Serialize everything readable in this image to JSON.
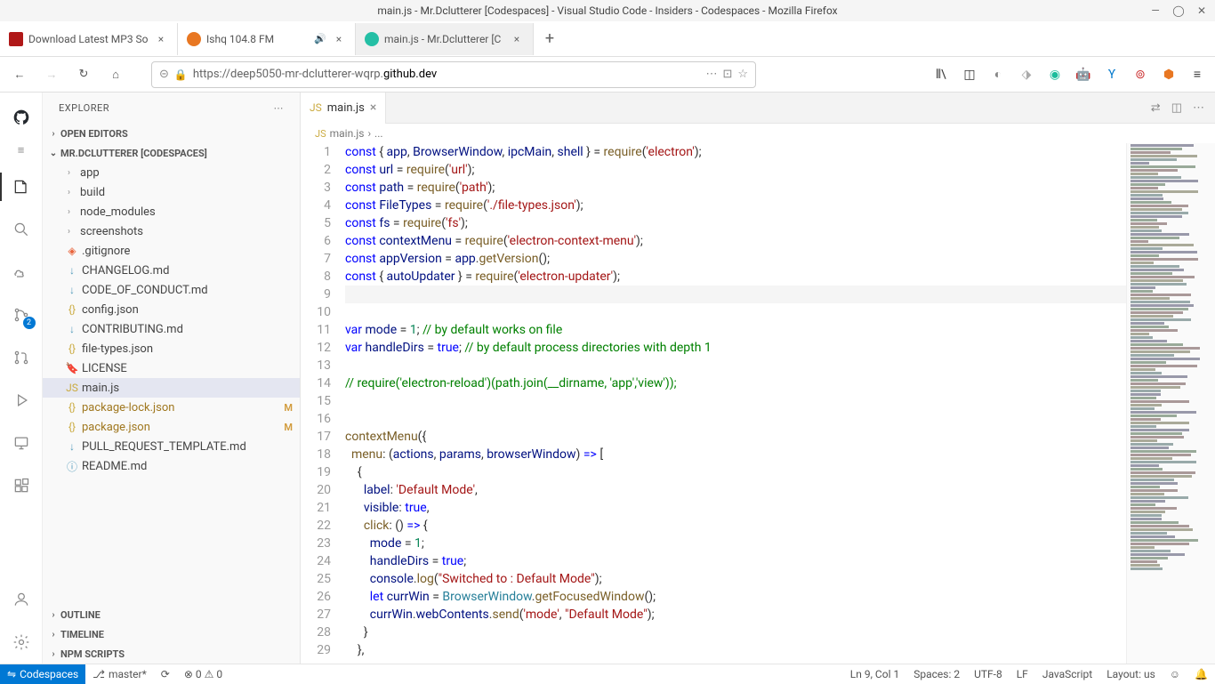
{
  "os": {
    "title": "main.js - Mr.Dclutterer [Codespaces] - Visual Studio Code - Insiders - Codespaces - Mozilla Firefox"
  },
  "browser": {
    "tabs": [
      {
        "title": "Download Latest MP3 So",
        "favicon": "#b01818"
      },
      {
        "title": "Ishq 104.8 FM",
        "favicon": "#e87722",
        "audio": true
      },
      {
        "title": "main.js - Mr.Dclutterer [C",
        "favicon": "#24bfa5",
        "active": true
      }
    ],
    "url_prefix": "https://",
    "url_sub": "deep5050-mr-dclutterer-wqrp.",
    "url_domain": "github.dev"
  },
  "sidebar": {
    "title": "EXPLORER",
    "sections": {
      "openEditors": "OPEN EDITORS",
      "repo": "MR.DCLUTTERER [CODESPACES]",
      "outline": "OUTLINE",
      "timeline": "TIMELINE",
      "npm": "NPM SCRIPTS"
    },
    "folders": [
      "app",
      "build",
      "node_modules",
      "screenshots"
    ],
    "files": [
      {
        "name": ".gitignore",
        "icon": "git"
      },
      {
        "name": "CHANGELOG.md",
        "icon": "md"
      },
      {
        "name": "CODE_OF_CONDUCT.md",
        "icon": "md"
      },
      {
        "name": "config.json",
        "icon": "json"
      },
      {
        "name": "CONTRIBUTING.md",
        "icon": "md"
      },
      {
        "name": "file-types.json",
        "icon": "json"
      },
      {
        "name": "LICENSE",
        "icon": "lic"
      },
      {
        "name": "main.js",
        "icon": "js",
        "selected": true
      },
      {
        "name": "package-lock.json",
        "icon": "json",
        "mod": "M"
      },
      {
        "name": "package.json",
        "icon": "json",
        "mod": "M"
      },
      {
        "name": "PULL_REQUEST_TEMPLATE.md",
        "icon": "md"
      },
      {
        "name": "README.md",
        "icon": "info"
      }
    ]
  },
  "editor": {
    "tab": "main.js",
    "breadcrumb": [
      "main.js",
      "..."
    ],
    "lines": 29
  },
  "status": {
    "remote": "Codespaces",
    "branch": "master*",
    "sync": "⟳",
    "errors": "⊗ 0 ⚠ 0",
    "pos": "Ln 9, Col 1",
    "spaces": "Spaces: 2",
    "enc": "UTF-8",
    "eol": "LF",
    "lang": "JavaScript",
    "layout": "Layout: us",
    "feedback": "☺",
    "bell": "🔔"
  },
  "scm_badge": "2"
}
